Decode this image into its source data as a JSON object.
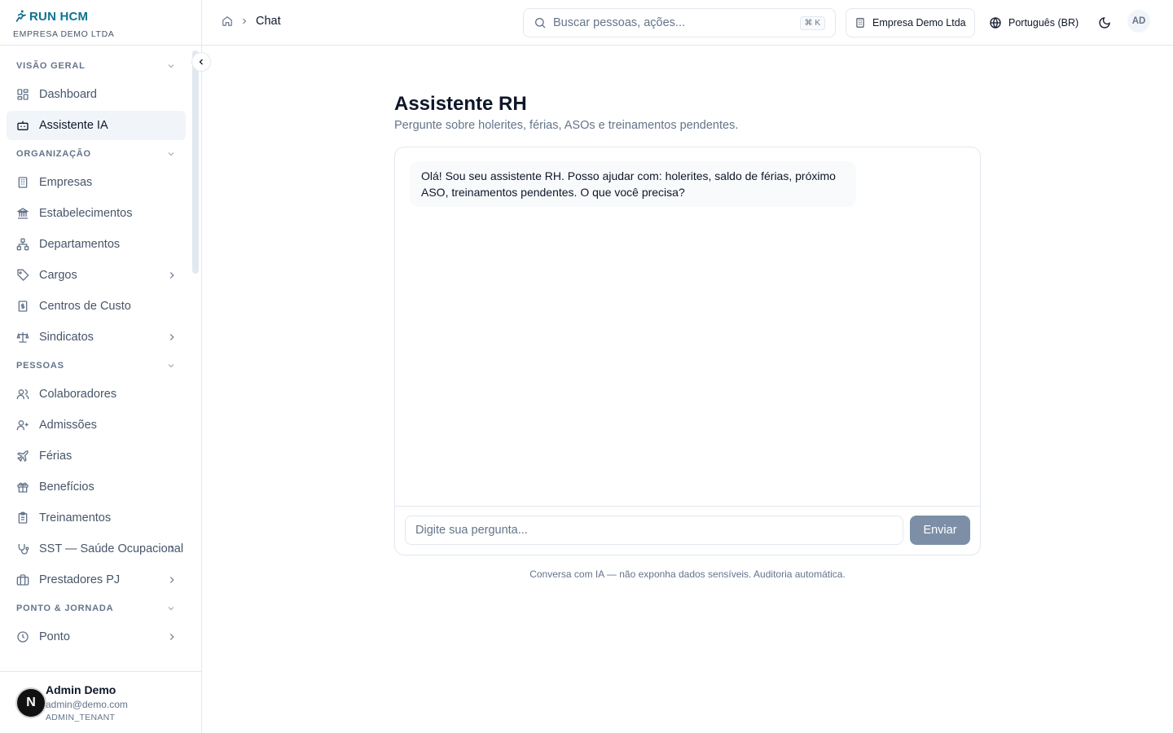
{
  "brand": {
    "name": "RUN HCM",
    "company": "EMPRESA DEMO LTDA"
  },
  "sidebar": {
    "sections": [
      {
        "title": "VISÃO GERAL",
        "items": [
          {
            "label": "Dashboard",
            "icon": "grid-icon",
            "has_children": false,
            "active": false
          },
          {
            "label": "Assistente IA",
            "icon": "bot-icon",
            "has_children": false,
            "active": true
          }
        ]
      },
      {
        "title": "ORGANIZAÇÃO",
        "items": [
          {
            "label": "Empresas",
            "icon": "building-icon",
            "has_children": false
          },
          {
            "label": "Estabelecimentos",
            "icon": "landmark-icon",
            "has_children": false
          },
          {
            "label": "Departamentos",
            "icon": "network-icon",
            "has_children": false
          },
          {
            "label": "Cargos",
            "icon": "tag-icon",
            "has_children": true
          },
          {
            "label": "Centros de Custo",
            "icon": "receipt-icon",
            "has_children": false
          },
          {
            "label": "Sindicatos",
            "icon": "scale-icon",
            "has_children": true
          }
        ]
      },
      {
        "title": "PESSOAS",
        "items": [
          {
            "label": "Colaboradores",
            "icon": "users-icon",
            "has_children": false
          },
          {
            "label": "Admissões",
            "icon": "user-plus-icon",
            "has_children": false
          },
          {
            "label": "Férias",
            "icon": "plane-icon",
            "has_children": false
          },
          {
            "label": "Benefícios",
            "icon": "gift-icon",
            "has_children": false
          },
          {
            "label": "Treinamentos",
            "icon": "clipboard-icon",
            "has_children": false
          },
          {
            "label": "SST — Saúde Ocupacional",
            "icon": "stethoscope-icon",
            "has_children": true
          },
          {
            "label": "Prestadores PJ",
            "icon": "briefcase-icon",
            "has_children": true
          }
        ]
      },
      {
        "title": "PONTO & JORNADA",
        "items": [
          {
            "label": "Ponto",
            "icon": "clock-icon",
            "has_children": true
          }
        ]
      }
    ]
  },
  "user": {
    "initial": "N",
    "name": "Admin Demo",
    "email": "admin@demo.com",
    "role": "ADMIN_TENANT"
  },
  "header": {
    "breadcrumb_current": "Chat",
    "search_placeholder": "Buscar pessoas, ações...",
    "search_shortcut": "⌘ K",
    "company": "Empresa Demo Ltda",
    "language": "Português (BR)",
    "avatar_initials": "AD"
  },
  "main": {
    "title": "Assistente RH",
    "subtitle": "Pergunte sobre holerites, férias, ASOs e treinamentos pendentes.",
    "messages": [
      {
        "role": "assistant",
        "text": "Olá! Sou seu assistente RH. Posso ajudar com: holerites, saldo de férias, próximo ASO, treinamentos pendentes. O que você precisa?"
      }
    ],
    "input_placeholder": "Digite sua pergunta...",
    "send_label": "Enviar",
    "disclaimer": "Conversa com IA — não exponha dados sensíveis. Auditoria automática."
  },
  "colors": {
    "accent": "#0e7490",
    "send_button": "#7c8fa6",
    "active_bg": "#f1f5f9"
  }
}
